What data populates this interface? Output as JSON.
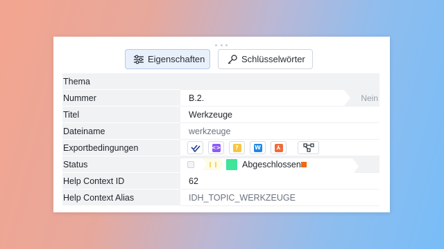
{
  "tabs": {
    "properties_label": "Eigenschaften",
    "keywords_label": "Schlüsselwörter"
  },
  "fields": {
    "thema": {
      "label": "Thema",
      "value": ""
    },
    "nummer": {
      "label": "Nummer",
      "value": "B.2.",
      "flag": "Nein"
    },
    "titel": {
      "label": "Titel",
      "value": "Werkzeuge"
    },
    "dateiname": {
      "label": "Dateiname",
      "value": "werkzeuge"
    },
    "exportbedingungen": {
      "label": "Exportbedingungen",
      "icons": [
        "double-check-icon",
        "code-icon",
        "help-icon",
        "word-icon",
        "pdf-icon",
        "workflow-icon"
      ]
    },
    "status": {
      "label": "Status",
      "value": "Abgeschlossen"
    },
    "help_context_id": {
      "label": "Help Context ID",
      "value": "62"
    },
    "help_context_alias": {
      "label": "Help Context Alias",
      "value": "IDH_TOPIC_WERKZEUGE"
    }
  },
  "colors": {
    "status_green": "#3ee59a",
    "status_orange": "#ee6a12",
    "code_purple": "#8b5cf6",
    "help_yellow": "#f5c542",
    "word_blue": "#1e88e5",
    "pdf_orange": "#f06a3a"
  }
}
